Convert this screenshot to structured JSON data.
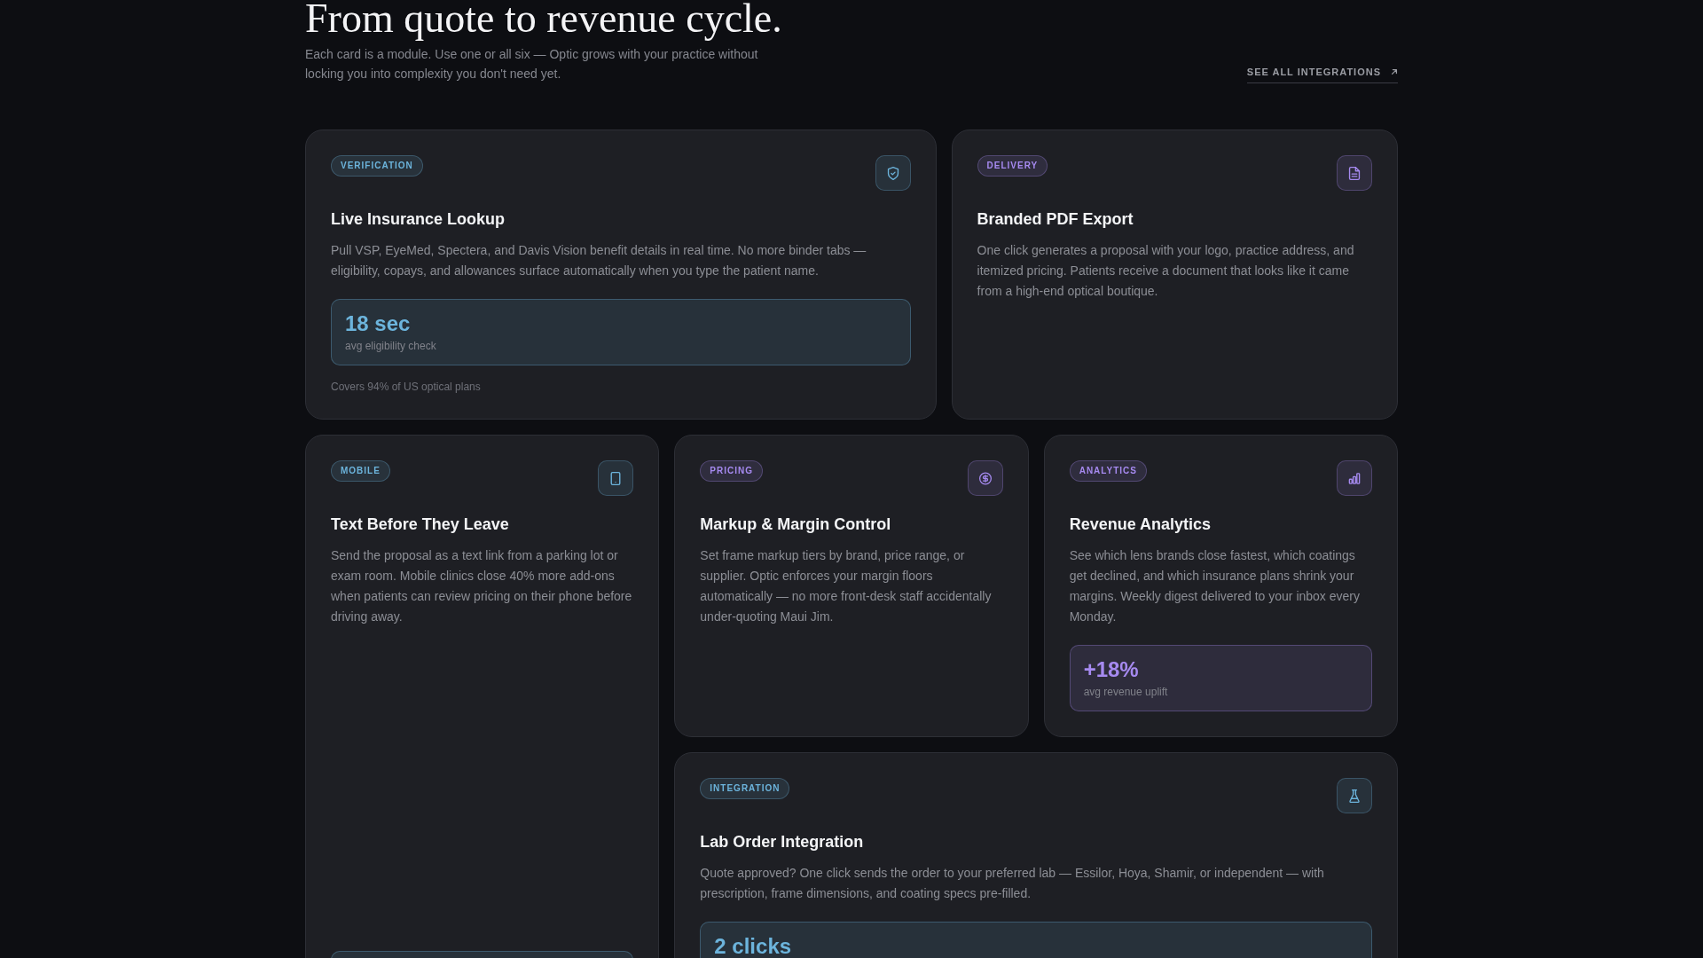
{
  "header": {
    "title": "From quote to revenue cycle.",
    "subtitle": "Each card is a module. Use one or all six — Optic grows with your practice without locking you into complexity you don't need yet.",
    "link": "SEE ALL INTEGRATIONS"
  },
  "cards": [
    {
      "kind": "insurance",
      "tag": "VERIFICATION",
      "color": "#6cb4dc",
      "title": "Live Insurance Lookup",
      "description": "Pull VSP, EyeMed, Spectera, and Davis Vision benefit details in real time. No more binder tabs — eligibility, copays, and allowances surface automatically when you type the patient name.",
      "stat": {
        "value": "18 sec",
        "label": "avg eligibility check"
      },
      "footnote": "Covers 94% of US optical plans"
    },
    {
      "kind": "export",
      "tag": "DELIVERY",
      "color": "#a68af0",
      "title": "Branded PDF Export",
      "description": "One click generates a proposal with your logo, practice address, and itemized pricing. Patients receive a document that looks like it came from a high-end optical boutique."
    },
    {
      "kind": "mobile",
      "tag": "MOBILE",
      "color": "#6cb4dc",
      "title": "Text Before They Leave",
      "description": "Send the proposal as a text link from a parking lot or exam room. Mobile clinics close 40% more add-ons when patients can review pricing on their phone before driving away.",
      "stat_panel": true
    },
    {
      "kind": "pricing",
      "tag": "PRICING",
      "color": "#a68af0",
      "title": "Markup & Margin Control",
      "description": "Set frame markup tiers by brand, price range, or supplier. Optic enforces your margin floors automatically — no more front-desk staff accidentally under-quoting Maui Jim."
    },
    {
      "kind": "analytics",
      "tag": "ANALYTICS",
      "color": "#a68af0",
      "title": "Revenue Analytics",
      "description": "See which lens brands close fastest, which coatings get declined, and which insurance plans shrink your margins. Weekly digest delivered to your inbox every Monday.",
      "stat": {
        "value": "+18%",
        "label": "avg revenue uplift"
      }
    },
    {
      "kind": "lab",
      "tag": "INTEGRATION",
      "color": "#6cb4dc",
      "title": "Lab Order Integration",
      "description": "Quote approved? One click sends the order to your preferred lab — Essilor, Hoya, Shamir, or independent — with prescription, frame dimensions, and coating specs pre-filled.",
      "stat": {
        "value": "2 clicks"
      }
    }
  ]
}
